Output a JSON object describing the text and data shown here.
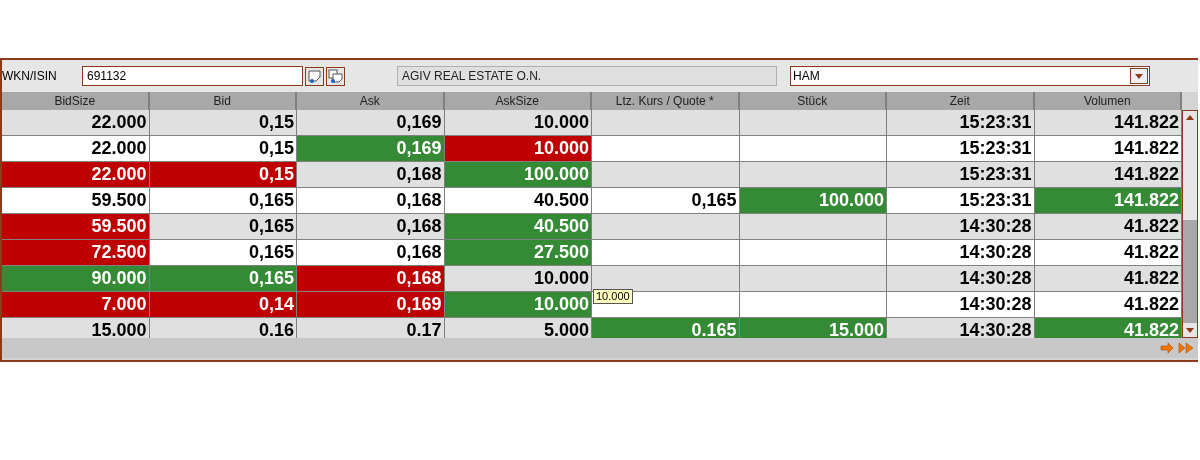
{
  "search": {
    "label": "WKN/ISIN",
    "value": "691132"
  },
  "security_name": "AGIV REAL ESTATE O.N.",
  "exchange": {
    "value": "HAM"
  },
  "table": {
    "columns": [
      "BidSize",
      "Bid",
      "Ask",
      "AskSize",
      "Ltz. Kurs / Quote *",
      "Stück",
      "Zeit",
      "Volumen"
    ],
    "rows": [
      [
        {
          "text": "22.000"
        },
        {
          "text": "0,15"
        },
        {
          "text": "0,169"
        },
        {
          "text": "10.000"
        },
        null,
        null,
        {
          "text": "15:23:31"
        },
        {
          "text": "141.822"
        }
      ],
      [
        {
          "text": "22.000"
        },
        {
          "text": "0,15"
        },
        {
          "text": "0,169",
          "color": "#358a35"
        },
        {
          "text": "10.000",
          "color": "#bf0000"
        },
        null,
        null,
        {
          "text": "15:23:31"
        },
        {
          "text": "141.822"
        }
      ],
      [
        {
          "text": "22.000",
          "color": "#bf0000"
        },
        {
          "text": "0,15",
          "color": "#bf0000"
        },
        {
          "text": "0,168"
        },
        {
          "text": "100.000",
          "color": "#358a35"
        },
        null,
        null,
        {
          "text": "15:23:31"
        },
        {
          "text": "141.822"
        }
      ],
      [
        {
          "text": "59.500"
        },
        {
          "text": "0,165"
        },
        {
          "text": "0,168"
        },
        {
          "text": "40.500"
        },
        {
          "text": "0,165"
        },
        {
          "text": "100.000",
          "color": "#358a35"
        },
        {
          "text": "15:23:31"
        },
        {
          "text": "141.822",
          "color": "#358a35"
        }
      ],
      [
        {
          "text": "59.500",
          "color": "#bf0000"
        },
        {
          "text": "0,165"
        },
        {
          "text": "0,168"
        },
        {
          "text": "40.500",
          "color": "#358a35"
        },
        null,
        null,
        {
          "text": "14:30:28"
        },
        {
          "text": "41.822"
        }
      ],
      [
        {
          "text": "72.500",
          "color": "#bf0000"
        },
        {
          "text": "0,165"
        },
        {
          "text": "0,168"
        },
        {
          "text": "27.500",
          "color": "#358a35"
        },
        null,
        null,
        {
          "text": "14:30:28"
        },
        {
          "text": "41.822"
        }
      ],
      [
        {
          "text": "90.000",
          "color": "#358a35"
        },
        {
          "text": "0,165",
          "color": "#358a35"
        },
        {
          "text": "0,168",
          "color": "#bf0000"
        },
        {
          "text": "10.000"
        },
        null,
        null,
        {
          "text": "14:30:28"
        },
        {
          "text": "41.822"
        }
      ],
      [
        {
          "text": "7.000",
          "color": "#bf0000"
        },
        {
          "text": "0,14",
          "color": "#bf0000"
        },
        {
          "text": "0,169",
          "color": "#bf0000"
        },
        {
          "text": "10.000",
          "color": "#358a35"
        },
        null,
        null,
        {
          "text": "14:30:28"
        },
        {
          "text": "41.822"
        }
      ],
      [
        {
          "text": "15.000"
        },
        {
          "text": "0.16"
        },
        {
          "text": "0.17"
        },
        {
          "text": "5.000"
        },
        {
          "text": "0.165",
          "color": "#358a35"
        },
        {
          "text": "15.000",
          "color": "#358a35"
        },
        {
          "text": "14:30:28"
        },
        {
          "text": "41.822",
          "color": "#358a35"
        }
      ]
    ]
  },
  "tooltip": "10.000"
}
